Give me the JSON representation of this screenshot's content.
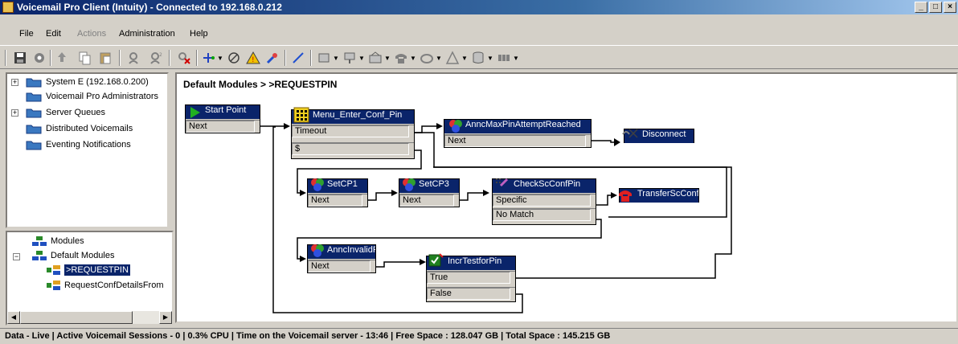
{
  "window": {
    "title": "Voicemail Pro Client (Intuity) - Connected to 192.168.0.212"
  },
  "menu": {
    "file": "File",
    "edit": "Edit",
    "actions": "Actions",
    "administration": "Administration",
    "help": "Help"
  },
  "tree": {
    "items": [
      {
        "label": "System E (192.168.0.200)",
        "expandable": true
      },
      {
        "label": "Voicemail Pro Administrators",
        "expandable": false
      },
      {
        "label": "Server Queues",
        "expandable": true
      },
      {
        "label": "Distributed Voicemails",
        "expandable": false
      },
      {
        "label": "Eventing Notifications",
        "expandable": false
      }
    ]
  },
  "modules": {
    "root": "Modules",
    "default": "Default Modules",
    "items": [
      {
        "label": ">REQUESTPIN",
        "selected": true
      },
      {
        "label": "RequestConfDetailsFrom",
        "selected": false
      }
    ]
  },
  "canvas": {
    "breadcrumb": "Default Modules > >REQUESTPIN",
    "nodes": {
      "start": {
        "title": "Start Point",
        "rows": [
          "Next"
        ]
      },
      "menu": {
        "title": "Menu_Enter_Conf_Pin",
        "rows": [
          "Timeout",
          "$"
        ]
      },
      "annc_max": {
        "title": "AnncMaxPinAttemptReached",
        "rows": [
          "Next"
        ]
      },
      "disconnect": {
        "title": "Disconnect",
        "rows": []
      },
      "setcp1": {
        "title": "SetCP1",
        "rows": [
          "Next"
        ]
      },
      "setcp3": {
        "title": "SetCP3",
        "rows": [
          "Next"
        ]
      },
      "check": {
        "title": "CheckScConfPin",
        "rows": [
          "Specific",
          "No Match"
        ]
      },
      "transfer": {
        "title": "TransferScConf",
        "rows": []
      },
      "annc_invalid": {
        "title": "AnncInvalidPin",
        "rows": [
          "Next"
        ]
      },
      "incr": {
        "title": "IncrTestforPin",
        "rows": [
          "True",
          "False"
        ]
      }
    }
  },
  "status": {
    "text": "Data - Live  |  Active Voicemail Sessions - 0  |  0.3% CPU  |  Time on the Voicemail server - 13:46  |  Free Space : 128.047 GB  |  Total Space : 145.215 GB"
  },
  "colors": {
    "title_bar": "#0a246a",
    "node_header": "#0a246a",
    "canvas_bg": "#ffffff",
    "chrome": "#d4d0c8"
  }
}
